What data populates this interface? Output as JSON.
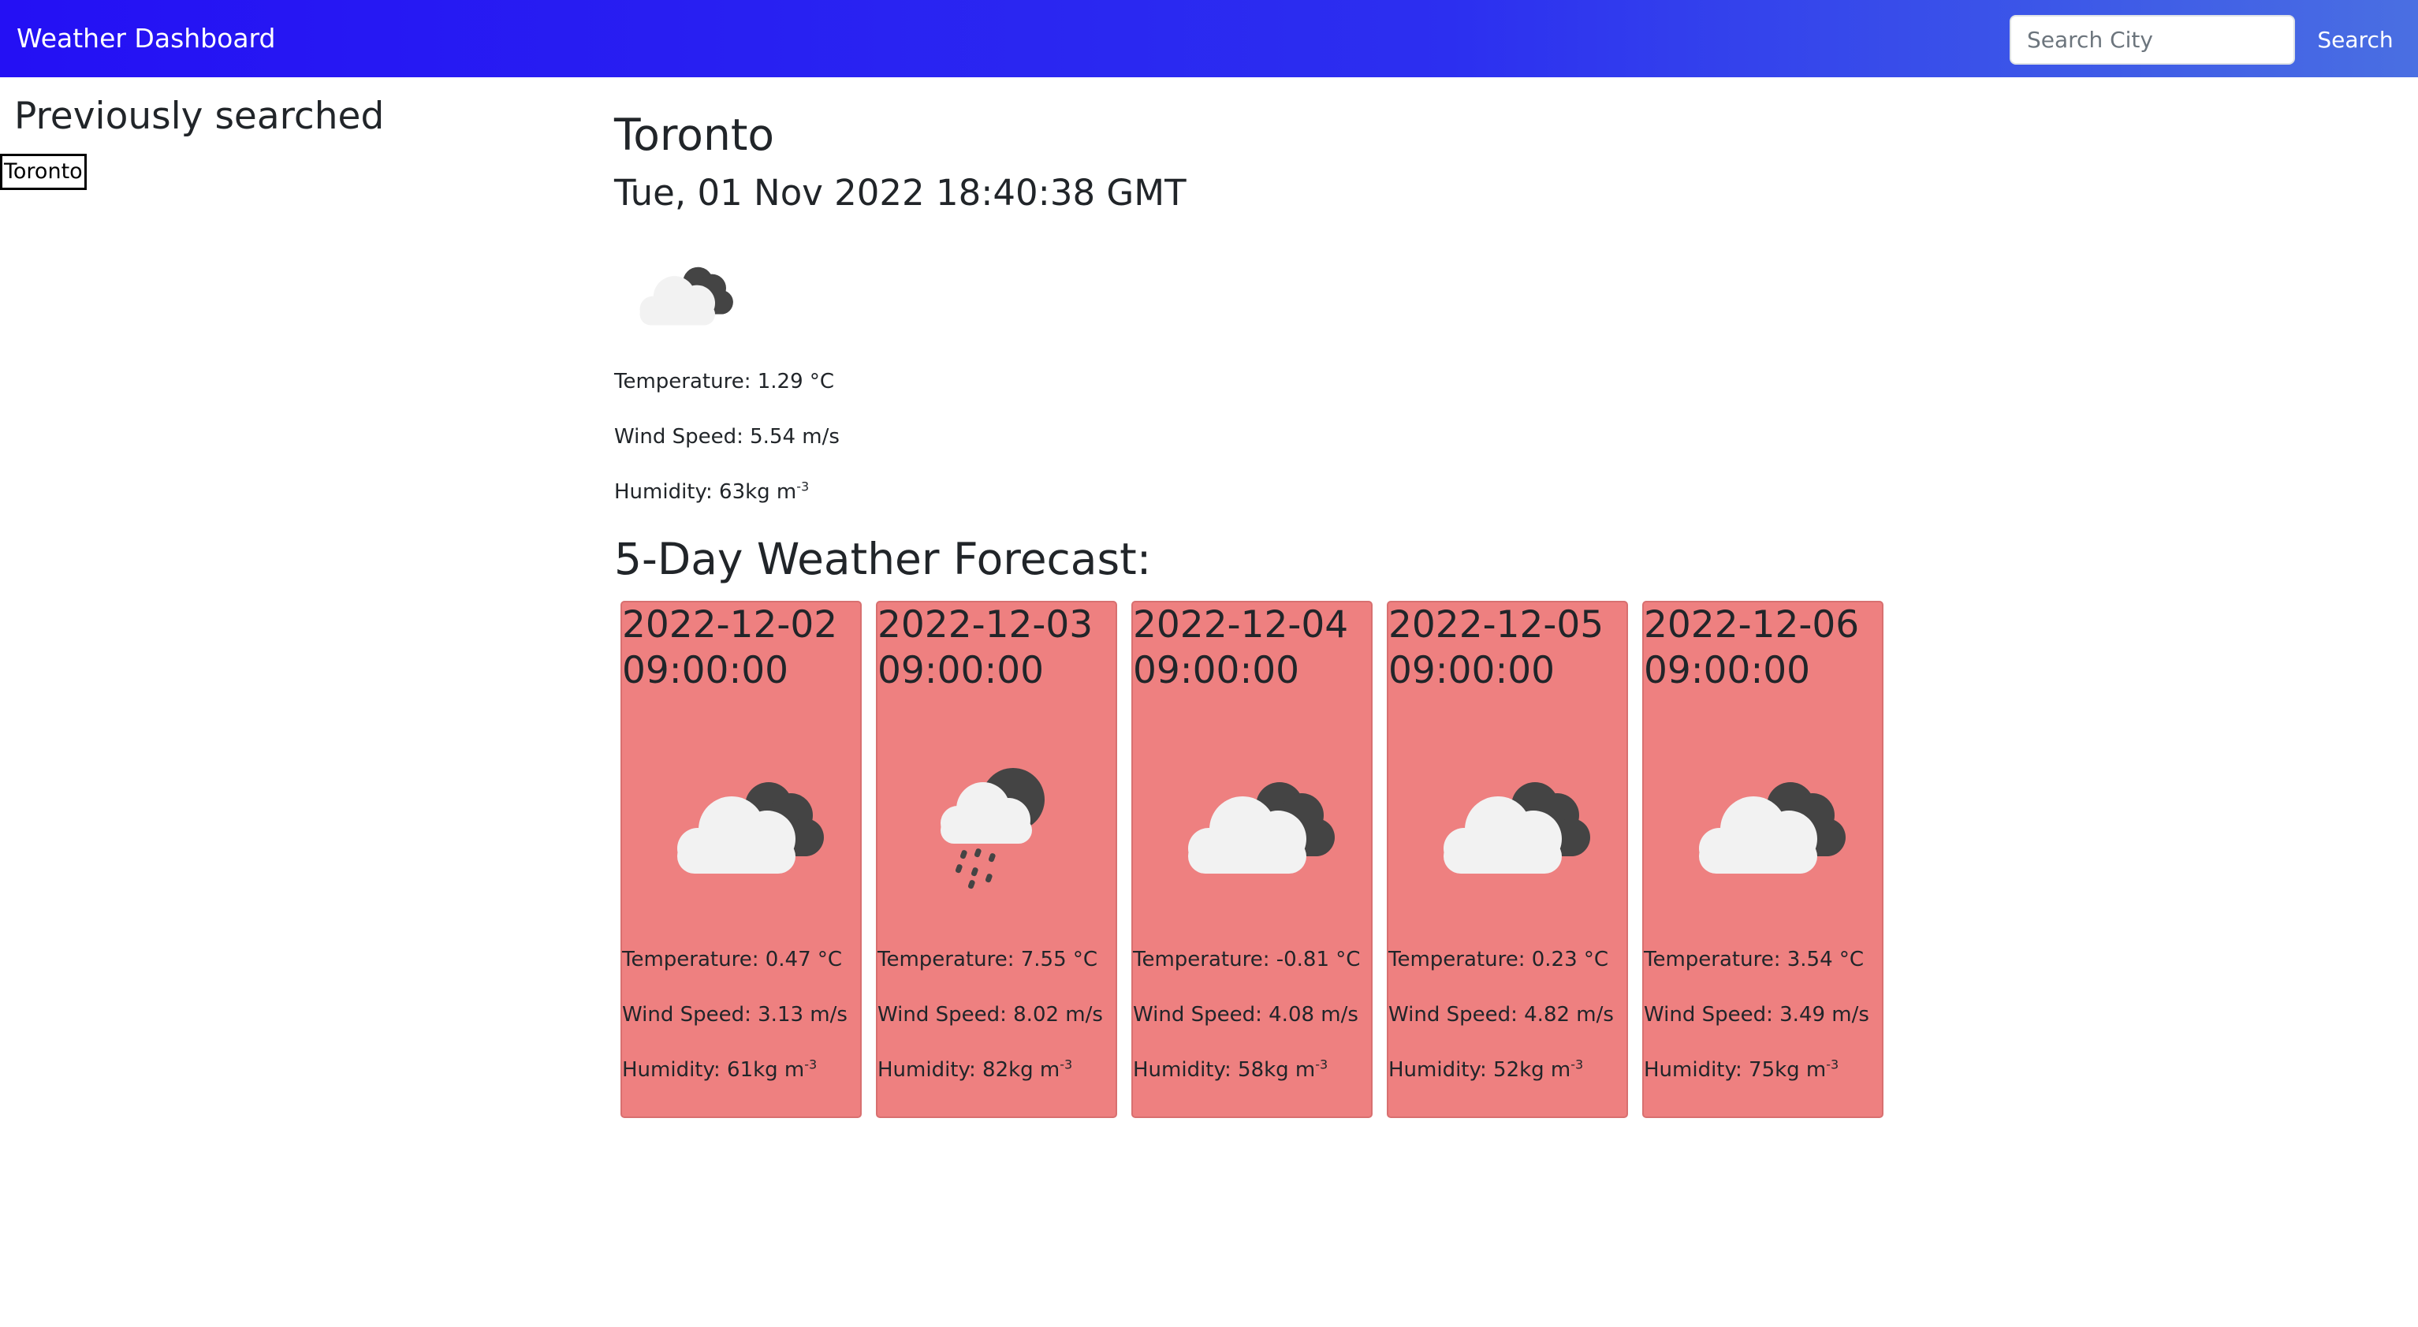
{
  "navbar": {
    "brand": "Weather Dashboard",
    "search_placeholder": "Search City",
    "search_value": "",
    "search_label": "Search"
  },
  "sidebar": {
    "title": "Previously searched",
    "history": [
      "Toronto"
    ]
  },
  "current": {
    "city": "Toronto",
    "datetime": "Tue, 01 Nov 2022 18:40:38 GMT",
    "icon": "cloudy-night-icon",
    "temperature": "Temperature: 1.29 °C",
    "wind": "Wind Speed: 5.54 m/s",
    "humidity": "Humidity: 63kg m",
    "humidity_exp": "-3"
  },
  "forecast": {
    "title": "5-Day Weather Forecast:",
    "days": [
      {
        "date": "2022-12-02 09:00:00",
        "icon": "cloudy-night-icon",
        "temperature": "Temperature: 0.47 °C",
        "wind": "Wind Speed: 3.13 m/s",
        "humidity": "Humidity: 61kg m",
        "humidity_exp": "-3"
      },
      {
        "date": "2022-12-03 09:00:00",
        "icon": "rain-night-icon",
        "temperature": "Temperature: 7.55 °C",
        "wind": "Wind Speed: 8.02 m/s",
        "humidity": "Humidity: 82kg m",
        "humidity_exp": "-3"
      },
      {
        "date": "2022-12-04 09:00:00",
        "icon": "cloudy-night-icon",
        "temperature": "Temperature: -0.81 °C",
        "wind": "Wind Speed: 4.08 m/s",
        "humidity": "Humidity: 58kg m",
        "humidity_exp": "-3"
      },
      {
        "date": "2022-12-05 09:00:00",
        "icon": "cloudy-night-icon",
        "temperature": "Temperature: 0.23 °C",
        "wind": "Wind Speed: 4.82 m/s",
        "humidity": "Humidity: 52kg m",
        "humidity_exp": "-3"
      },
      {
        "date": "2022-12-06 09:00:00",
        "icon": "cloudy-night-icon",
        "temperature": "Temperature: 3.54 °C",
        "wind": "Wind Speed: 3.49 m/s",
        "humidity": "Humidity: 75kg m",
        "humidity_exp": "-3"
      }
    ]
  },
  "colors": {
    "navbar_start": "#2410f4",
    "navbar_end": "#4a6fe2",
    "card_bg": "#ee8080",
    "cloud_light": "#f2f2f2",
    "cloud_dark": "#444444"
  }
}
